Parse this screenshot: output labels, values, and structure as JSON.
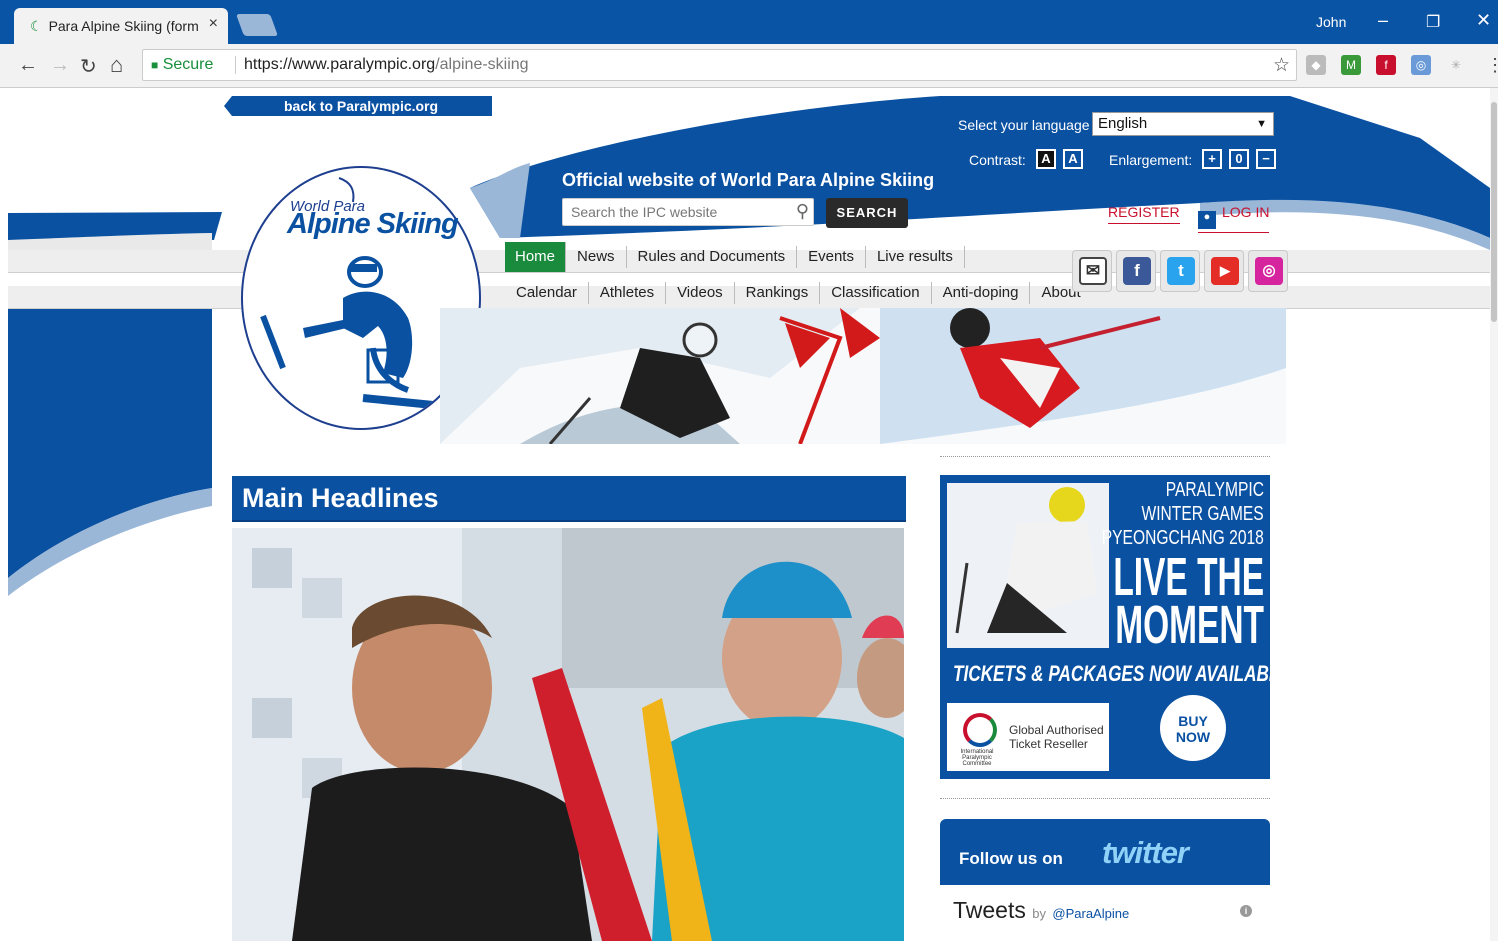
{
  "browser": {
    "tab_title": "Para Alpine Skiing (forme",
    "tab_close": "×",
    "user_name": "John",
    "win_min": "–",
    "win_restore": "❐",
    "win_close": "✕",
    "secure_label": "Secure",
    "url_host": "https://www.paralympic.org",
    "url_path": "/alpine-skiing",
    "back_glyph": "←",
    "forward_glyph": "→",
    "reload_glyph": "↻",
    "home_glyph": "⌂",
    "star_glyph": "☆",
    "menu_glyph": "⋮"
  },
  "header": {
    "back_link": "back to Paralympic.org",
    "language_label": "Select your language",
    "language_value": "English",
    "contrast_label": "Contrast:",
    "contrast_a1": "A",
    "contrast_a2": "A",
    "enlargement_label": "Enlargement:",
    "enlarge_plus": "+",
    "enlarge_zero": "0",
    "enlarge_minus": "−",
    "official_title": "Official website of World Para Alpine Skiing",
    "search_placeholder": "Search the IPC website",
    "search_button": "SEARCH",
    "register": "REGISTER",
    "login": "LOG IN",
    "logo_top": "World Para",
    "logo_main": "Alpine Skiing"
  },
  "menu": {
    "row1": [
      "Home",
      "News",
      "Rules and Documents",
      "Events",
      "Live results"
    ],
    "row2": [
      "Calendar",
      "Athletes",
      "Videos",
      "Rankings",
      "Classification",
      "Anti-doping",
      "About"
    ]
  },
  "social": [
    "email-icon",
    "facebook-icon",
    "twitter-icon",
    "youtube-icon",
    "instagram-icon"
  ],
  "main": {
    "headlines_title": "Main Headlines"
  },
  "ad": {
    "line1": "PARALYMPIC",
    "line2": "WINTER GAMES",
    "line3": "PYEONGCHANG 2018",
    "live": "LIVE THE",
    "moment": "MOMENT",
    "tickets": "TICKETS & PACKAGES NOW AVAILABLE",
    "reseller_line1": "Global Authorised",
    "reseller_line2": "Ticket Reseller",
    "ipc_small": "International Paralympic Committee",
    "buy_line1": "BUY",
    "buy_line2": "NOW"
  },
  "twitter": {
    "follow": "Follow us on",
    "brand": "twitter",
    "tweets": "Tweets",
    "by": "by",
    "handle": "@ParaAlpine"
  },
  "colors": {
    "brand_blue": "#0b51a2",
    "chrome_blue": "#0a54a5",
    "home_green": "#1a8a3c",
    "accent_red": "#c8102e"
  }
}
